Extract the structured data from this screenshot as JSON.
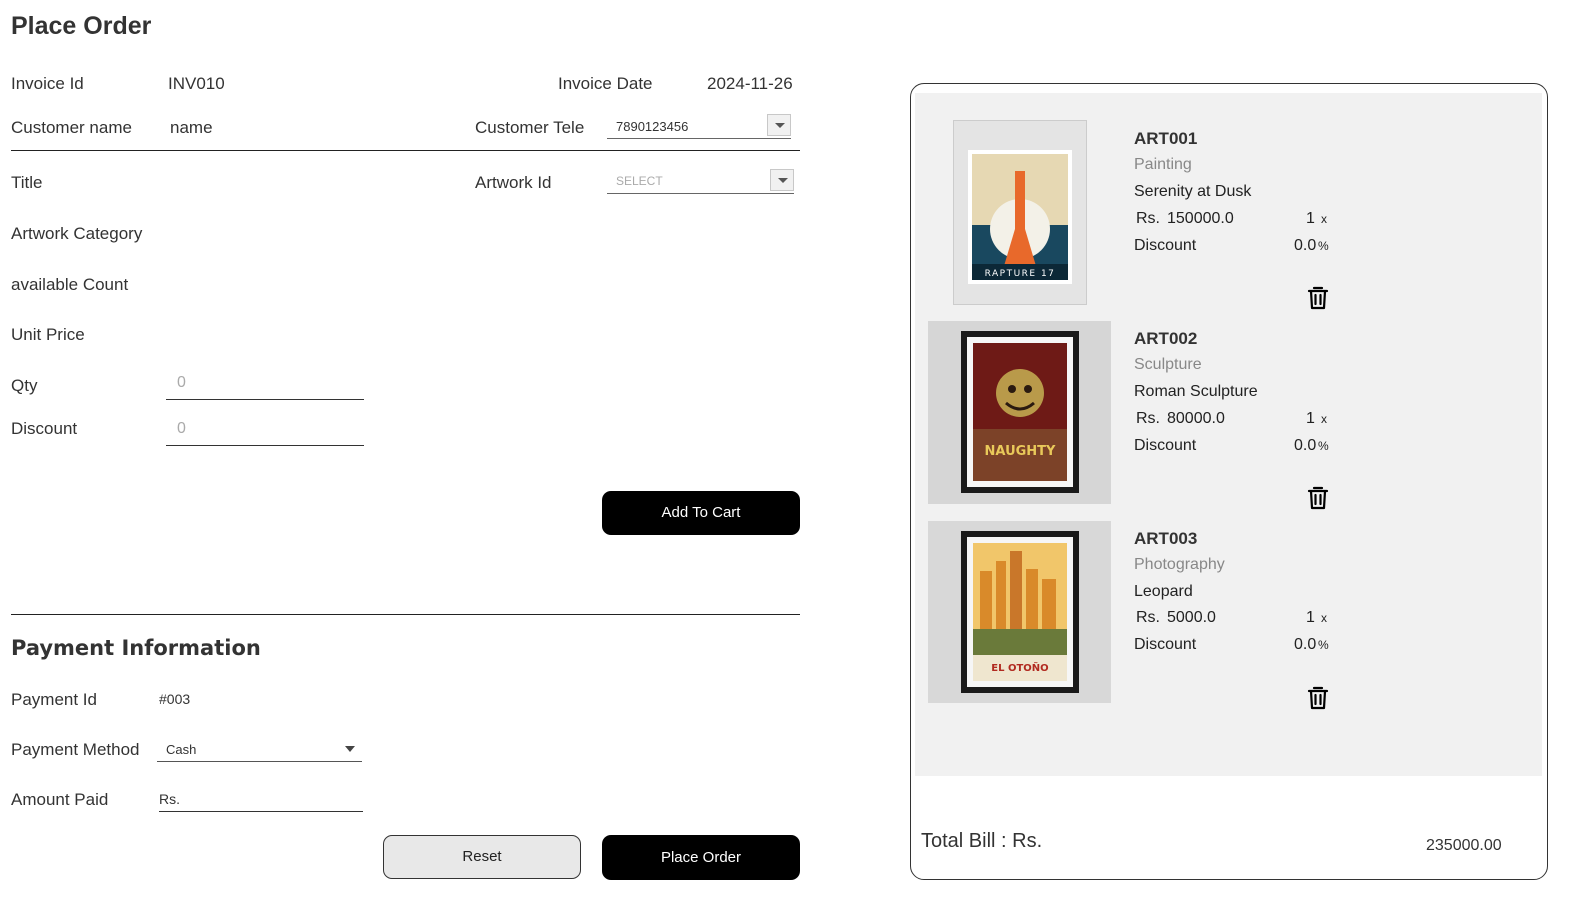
{
  "page": {
    "title": "Place Order"
  },
  "invoice": {
    "id_label": "Invoice Id",
    "id_value": "INV010",
    "date_label": "Invoice Date",
    "date_value": "2024-11-26",
    "customer_name_label": "Customer name",
    "customer_name_value": "name",
    "customer_tele_label": "Customer Tele",
    "customer_tele_value": "7890123456"
  },
  "artwork": {
    "title_label": "Title",
    "artwork_id_label": "Artwork Id",
    "artwork_id_placeholder": "SELECT",
    "category_label": "Artwork Category",
    "available_count_label": "available  Count",
    "unit_price_label": "Unit Price",
    "qty_label": "Qty",
    "qty_placeholder": "0",
    "discount_label": "Discount",
    "discount_placeholder": "0",
    "add_to_cart_label": "Add To Cart"
  },
  "payment": {
    "heading": "Payment Information",
    "id_label": "Payment Id",
    "id_value": "#003",
    "method_label": "Payment Method",
    "method_value": "Cash",
    "amount_label": "Amount Paid",
    "amount_value": "Rs.",
    "reset_label": "Reset",
    "place_order_label": "Place  Order"
  },
  "cart": {
    "items": [
      {
        "id": "ART001",
        "category": "Painting",
        "title": "Serenity at Dusk",
        "currency": "Rs.",
        "price": "150000.0",
        "qty": "1",
        "times": "x",
        "discount_label": "Discount",
        "discount": "0.0",
        "percent": "%",
        "poster_text": "RAPTURE 17"
      },
      {
        "id": "ART002",
        "category": "Sculpture",
        "title": "Roman Sculpture",
        "currency": "Rs.",
        "price": "80000.0",
        "qty": "1",
        "times": "x",
        "discount_label": "Discount",
        "discount": "0.0",
        "percent": "%",
        "poster_text": "NAUGHTY"
      },
      {
        "id": "ART003",
        "category": "Photography",
        "title": "Leopard",
        "currency": "Rs.",
        "price": "5000.0",
        "qty": "1",
        "times": "x",
        "discount_label": "Discount",
        "discount": "0.0",
        "percent": "%",
        "poster_text": "EL OTOÑO"
      }
    ],
    "total_label": "Total Bill : Rs.",
    "total_value": "235000.00"
  },
  "icons": {
    "delete": "trash-icon",
    "dropdown": "chevron-down-icon"
  },
  "colors": {
    "primary_button": "#000000",
    "secondary_button": "#e8e8e8",
    "cart_background": "#f1f1f1"
  }
}
